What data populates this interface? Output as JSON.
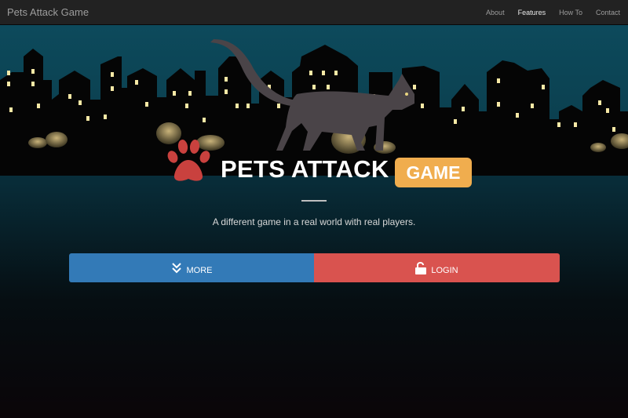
{
  "navbar": {
    "brand": "Pets Attack Game",
    "links": [
      {
        "label": "About",
        "active": false
      },
      {
        "label": "Features",
        "active": true
      },
      {
        "label": "How To",
        "active": false
      },
      {
        "label": "Contact",
        "active": false
      }
    ]
  },
  "hero": {
    "title": "PETS ATTACK",
    "badge": "GAME",
    "tagline": "A different game in a real world with real players."
  },
  "buttons": {
    "more": {
      "label": "MORE",
      "icon": "double-chevron-down-icon"
    },
    "login": {
      "label": "LOGIN",
      "icon": "unlock-icon"
    }
  },
  "colors": {
    "navbar": "#222222",
    "sky": "#0c4456",
    "badge": "#f0ad4e",
    "more_button": "#337ab7",
    "login_button": "#d9534f",
    "paw": "#c9413e",
    "window_light": "#f7e9a6"
  }
}
